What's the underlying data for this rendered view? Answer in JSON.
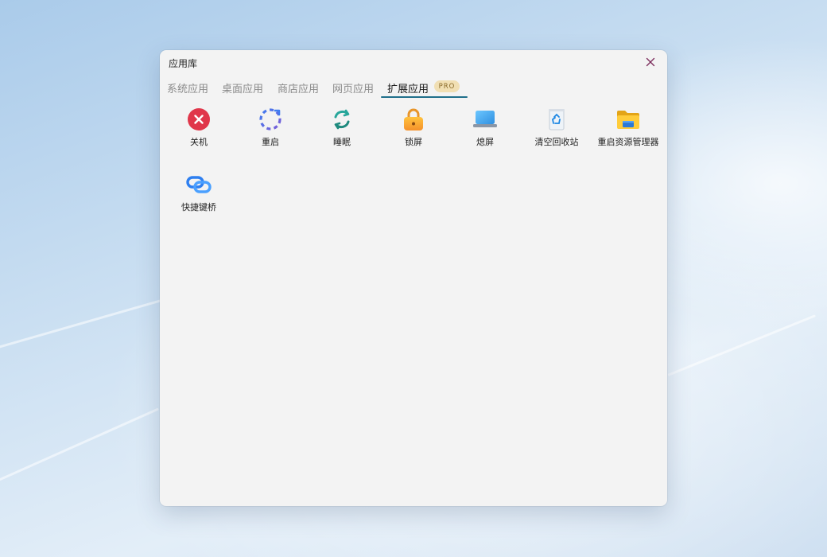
{
  "window": {
    "title": "应用库"
  },
  "tabs": [
    {
      "label": "系统应用",
      "active": false
    },
    {
      "label": "桌面应用",
      "active": false
    },
    {
      "label": "商店应用",
      "active": false
    },
    {
      "label": "网页应用",
      "active": false
    },
    {
      "label": "扩展应用",
      "active": true,
      "badge": "PRO"
    }
  ],
  "apps": [
    {
      "label": "关机",
      "icon": "shutdown-icon"
    },
    {
      "label": "重启",
      "icon": "restart-icon"
    },
    {
      "label": "睡眠",
      "icon": "sleep-icon"
    },
    {
      "label": "锁屏",
      "icon": "lock-icon"
    },
    {
      "label": "熄屏",
      "icon": "screen-off-icon"
    },
    {
      "label": "清空回收站",
      "icon": "recycle-bin-icon"
    },
    {
      "label": "重启资源管理器",
      "icon": "folder-icon"
    },
    {
      "label": "快捷键桥",
      "icon": "link-icon"
    }
  ],
  "colors": {
    "accent_underline": "#1f6f8b",
    "pro_badge_bg": "#f1dfb3",
    "close_icon": "#7a2a5a"
  }
}
